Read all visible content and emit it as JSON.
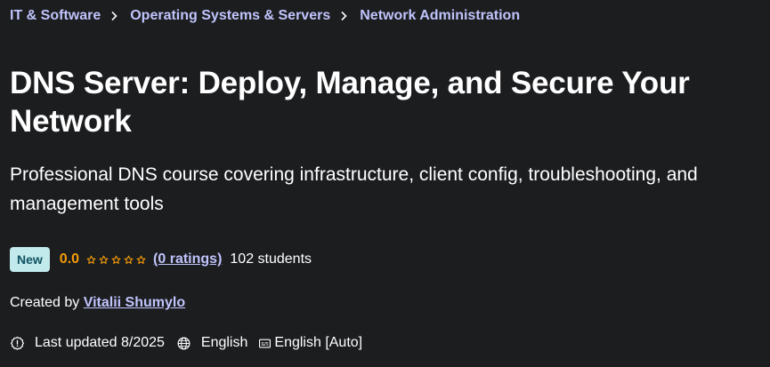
{
  "breadcrumb": [
    {
      "label": "IT & Software"
    },
    {
      "label": "Operating Systems & Servers"
    },
    {
      "label": "Network Administration"
    }
  ],
  "course": {
    "title": "DNS Server: Deploy, Manage, and Secure Your Network",
    "subtitle": "Professional DNS course covering infrastructure, client config, troubleshooting, and management tools",
    "badge": "New",
    "rating": "0.0",
    "stars_filled": 0,
    "stars_total": 5,
    "ratings_label": "(0 ratings)",
    "students": "102 students",
    "created_by_prefix": "Created by",
    "instructor": "Vitalii Shumylo",
    "last_updated": "Last updated 8/2025",
    "language": "English",
    "captions": "English [Auto]"
  },
  "colors": {
    "background": "#1c1d1f",
    "link": "#c0c4fc",
    "rating": "#f69c08",
    "badge_bg": "#c2e9eb",
    "badge_text": "#0d5261"
  },
  "icons": {
    "breadcrumb_separator": "chevron-right-icon",
    "star": "star-outline-icon",
    "last_updated": "alert-badge-icon",
    "language": "globe-icon",
    "captions": "closed-captions-icon"
  }
}
